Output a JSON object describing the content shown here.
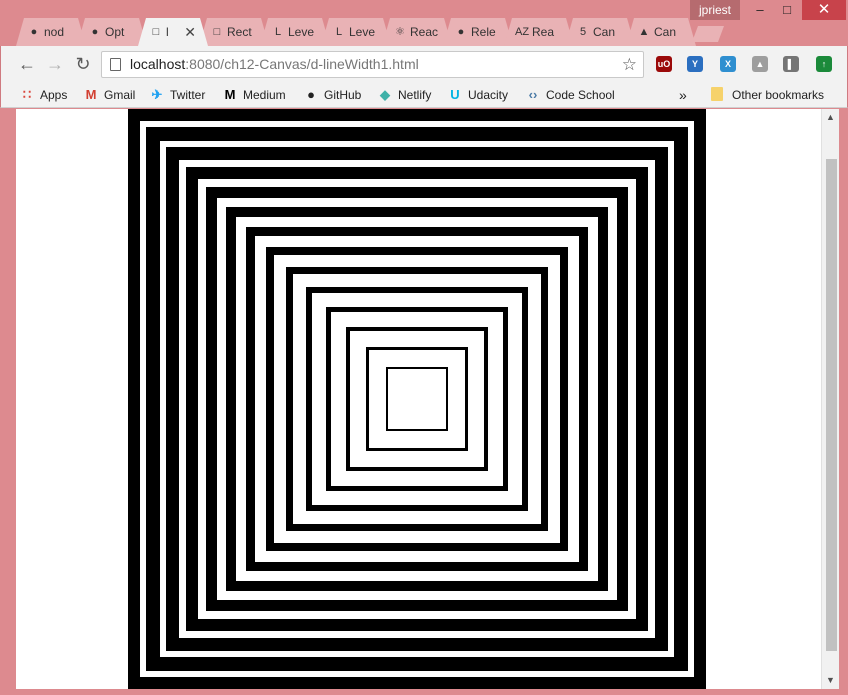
{
  "window": {
    "user": "jpriest",
    "min_symbol": "–",
    "max_symbol": "□",
    "close_symbol": "✕"
  },
  "tabs": [
    {
      "label": "nod",
      "icon": "github-icon",
      "glyph": "●"
    },
    {
      "label": "Opt",
      "icon": "github-icon",
      "glyph": "●"
    },
    {
      "label": "l",
      "icon": "page-icon",
      "glyph": "□",
      "active": true
    },
    {
      "label": "Rect",
      "icon": "page-icon",
      "glyph": "□"
    },
    {
      "label": "Leve",
      "icon": "level-up-icon",
      "glyph": "L"
    },
    {
      "label": "Leve",
      "icon": "level-up-icon",
      "glyph": "L"
    },
    {
      "label": "Reac",
      "icon": "react-icon",
      "glyph": "⚛"
    },
    {
      "label": "Rele",
      "icon": "github-icon",
      "glyph": "●"
    },
    {
      "label": "Rea",
      "icon": "az-icon",
      "glyph": "AZ"
    },
    {
      "label": "Can",
      "icon": "html5-icon",
      "glyph": "5"
    },
    {
      "label": "Can",
      "icon": "graduation-icon",
      "glyph": "▲"
    }
  ],
  "toolbar": {
    "back": "←",
    "forward": "→",
    "reload": "↻",
    "url_host": "localhost",
    "url_path": ":8080/ch12-Canvas/d-lineWidth1.html",
    "star": "☆",
    "extensions": [
      {
        "name": "ublock-icon",
        "glyph": "uO",
        "color": "#9b0a0a"
      },
      {
        "name": "y-extension-icon",
        "glyph": "Y",
        "color": "#2b6fc0"
      },
      {
        "name": "cross-extension-icon",
        "glyph": "X",
        "color": "#2f8fd0"
      },
      {
        "name": "drive-icon",
        "glyph": "▲",
        "color": "#9e9e9e"
      },
      {
        "name": "panel-icon",
        "glyph": "▌",
        "color": "#757575"
      },
      {
        "name": "upload-icon",
        "glyph": "↑",
        "color": "#1b8a3a"
      }
    ]
  },
  "bookmarks": [
    {
      "label": "Apps",
      "icon": "apps-grid-icon",
      "glyph": "∷",
      "color": "#d9453b"
    },
    {
      "label": "Gmail",
      "icon": "gmail-icon",
      "glyph": "M",
      "color": "#d23f31"
    },
    {
      "label": "Twitter",
      "icon": "twitter-icon",
      "glyph": "✈",
      "color": "#1da1f2"
    },
    {
      "label": "Medium",
      "icon": "medium-icon",
      "glyph": "M",
      "color": "#000000"
    },
    {
      "label": "GitHub",
      "icon": "github-icon",
      "glyph": "●",
      "color": "#222222"
    },
    {
      "label": "Netlify",
      "icon": "netlify-icon",
      "glyph": "◆",
      "color": "#3fb1a8"
    },
    {
      "label": "Udacity",
      "icon": "udacity-icon",
      "glyph": "U",
      "color": "#02b3e4"
    },
    {
      "label": "Code School",
      "icon": "code-icon",
      "glyph": "‹›",
      "color": "#4a7aa6"
    }
  ],
  "bookmarks_overflow": "»",
  "other_bookmarks": "Other bookmarks",
  "scroll": {
    "up": "▲",
    "down": "▼"
  }
}
